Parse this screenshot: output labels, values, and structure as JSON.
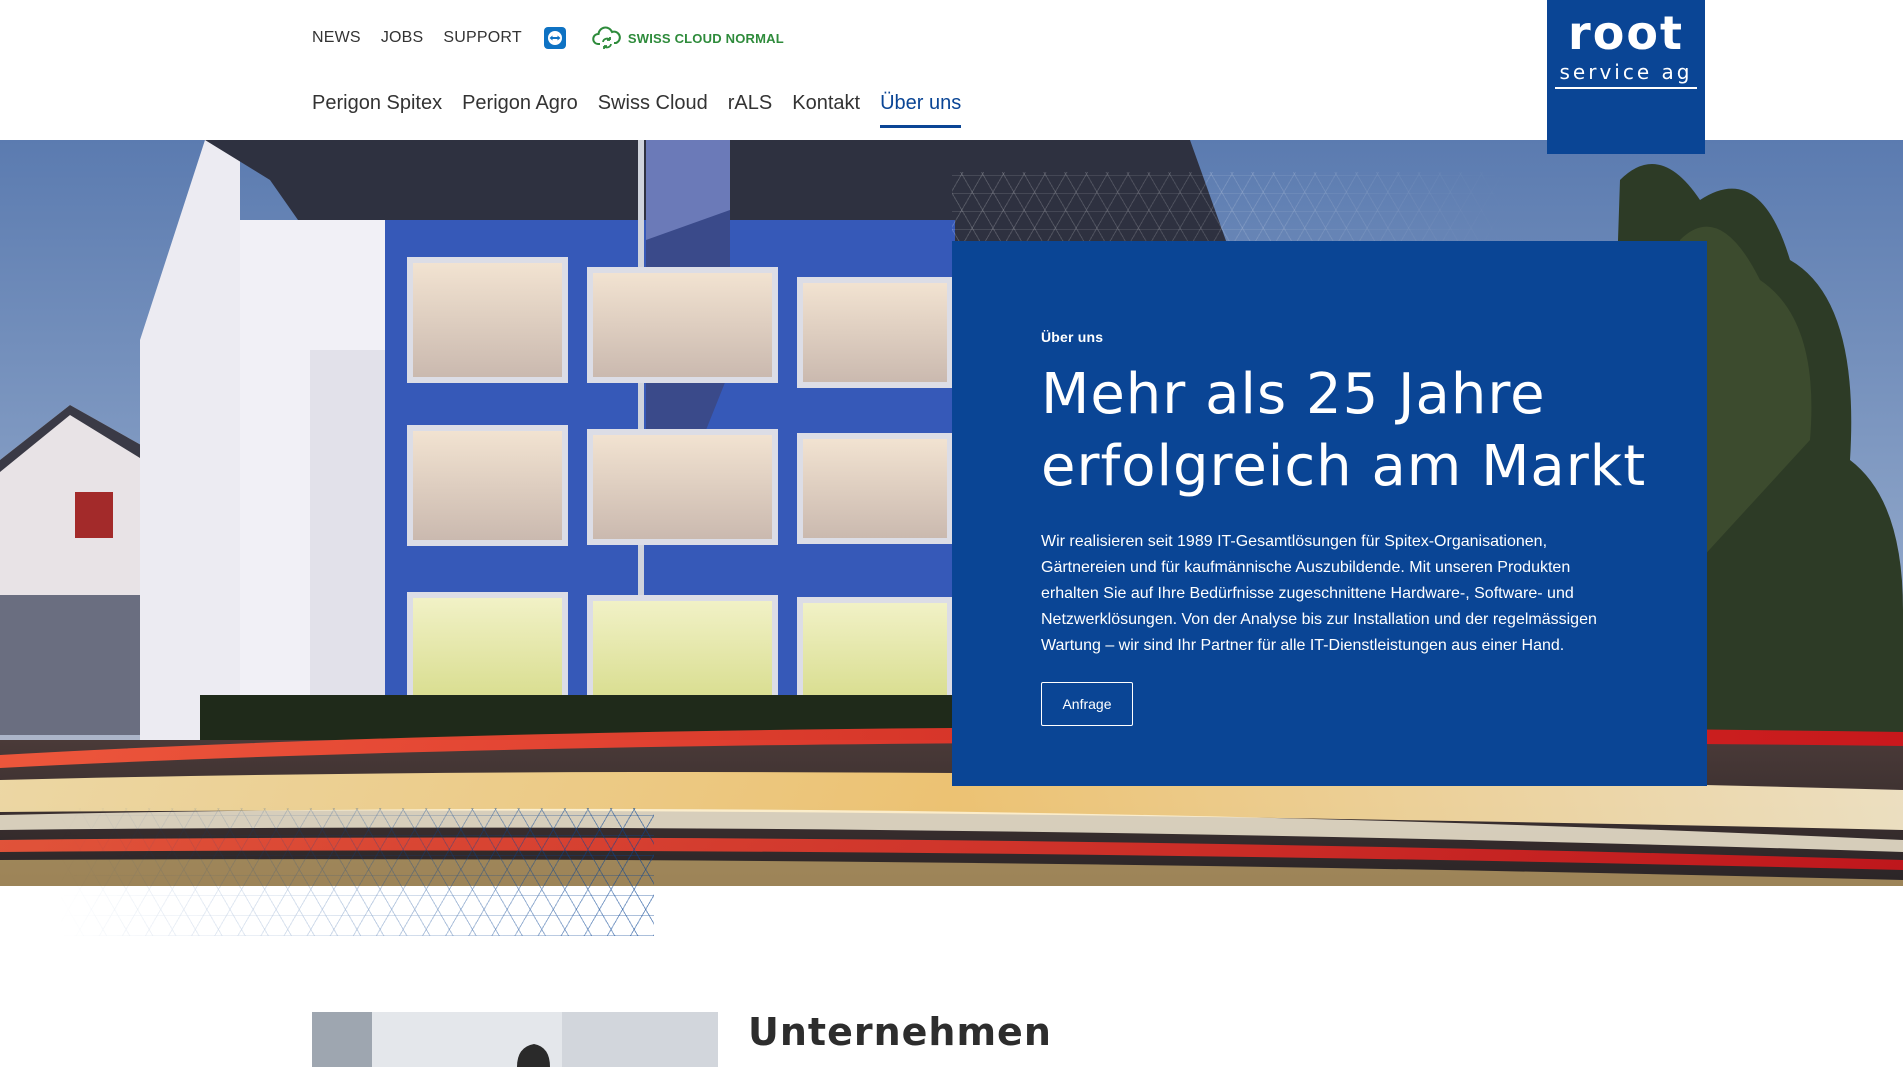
{
  "topbar": {
    "news_label": "NEWS",
    "jobs_label": "JOBS",
    "support_label": "SUPPORT",
    "support_icon": "teamviewer-icon",
    "cloud_icon": "cloud-sync-icon",
    "cloud_status": "SWISS CLOUD NORMAL",
    "cloud_status_color": "#2e8b3b"
  },
  "mainnav": {
    "items": [
      {
        "label": "Perigon Spitex",
        "active": false
      },
      {
        "label": "Perigon Agro",
        "active": false
      },
      {
        "label": "Swiss Cloud",
        "active": false
      },
      {
        "label": "rALS",
        "active": false
      },
      {
        "label": "Kontakt",
        "active": false
      },
      {
        "label": "Über uns",
        "active": true
      }
    ]
  },
  "logo": {
    "word": "root",
    "sub": "service ag"
  },
  "hero": {
    "eyebrow": "Über uns",
    "title_line1": "Mehr als 25 Jahre",
    "title_line2": "erfolgreich am Markt",
    "text": "Wir realisieren seit 1989 IT-Gesamtlösungen für Spitex-Organisationen, Gärtnereien und für kaufmännische Auszubildende. Mit unseren Produkten erhalten Sie auf Ihre Bedürfnisse zugeschnittene Hardware-, Software- und Netzwerklösungen. Von der Analyse bis zur Installation und der regelmässigen Wartung – wir sind Ihr Partner für alle IT-Dienstleistungen aus einer Hand.",
    "button_label": "Anfrage",
    "card_color": "#0a4595"
  },
  "section": {
    "title": "Unternehmen"
  },
  "colors": {
    "brand": "#0a4595",
    "text": "#333333"
  }
}
